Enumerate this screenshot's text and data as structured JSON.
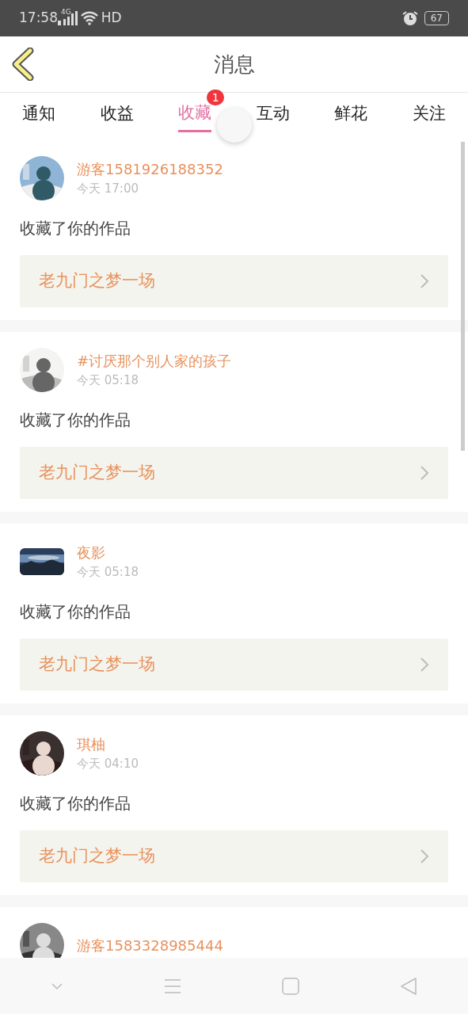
{
  "status_bar": {
    "time": "17:58",
    "network": "4G",
    "hd": "HD",
    "battery": "67"
  },
  "header": {
    "title": "消息"
  },
  "tabs": [
    {
      "label": "通知",
      "selected": false
    },
    {
      "label": "收益",
      "selected": false
    },
    {
      "label": "收藏",
      "selected": true,
      "badge": "1"
    },
    {
      "label": "互动",
      "selected": false
    },
    {
      "label": "鲜花",
      "selected": false
    },
    {
      "label": "关注",
      "selected": false
    }
  ],
  "messages": [
    {
      "user": "游客1581926188352",
      "time": "今天 17:00",
      "action": "收藏了你的作品",
      "work": "老九门之梦一场",
      "kind": "round"
    },
    {
      "user": "#讨厌那个别人家的孩子",
      "time": "今天 05:18",
      "action": "收藏了你的作品",
      "work": "老九门之梦一场",
      "kind": "round"
    },
    {
      "user": "夜影",
      "time": "今天 05:18",
      "action": "收藏了你的作品",
      "work": "老九门之梦一场",
      "kind": "wide"
    },
    {
      "user": "琪柚",
      "time": "今天 04:10",
      "action": "收藏了你的作品",
      "work": "老九门之梦一场",
      "kind": "round"
    },
    {
      "user": "游客1583328985444",
      "kind": "round"
    }
  ]
}
